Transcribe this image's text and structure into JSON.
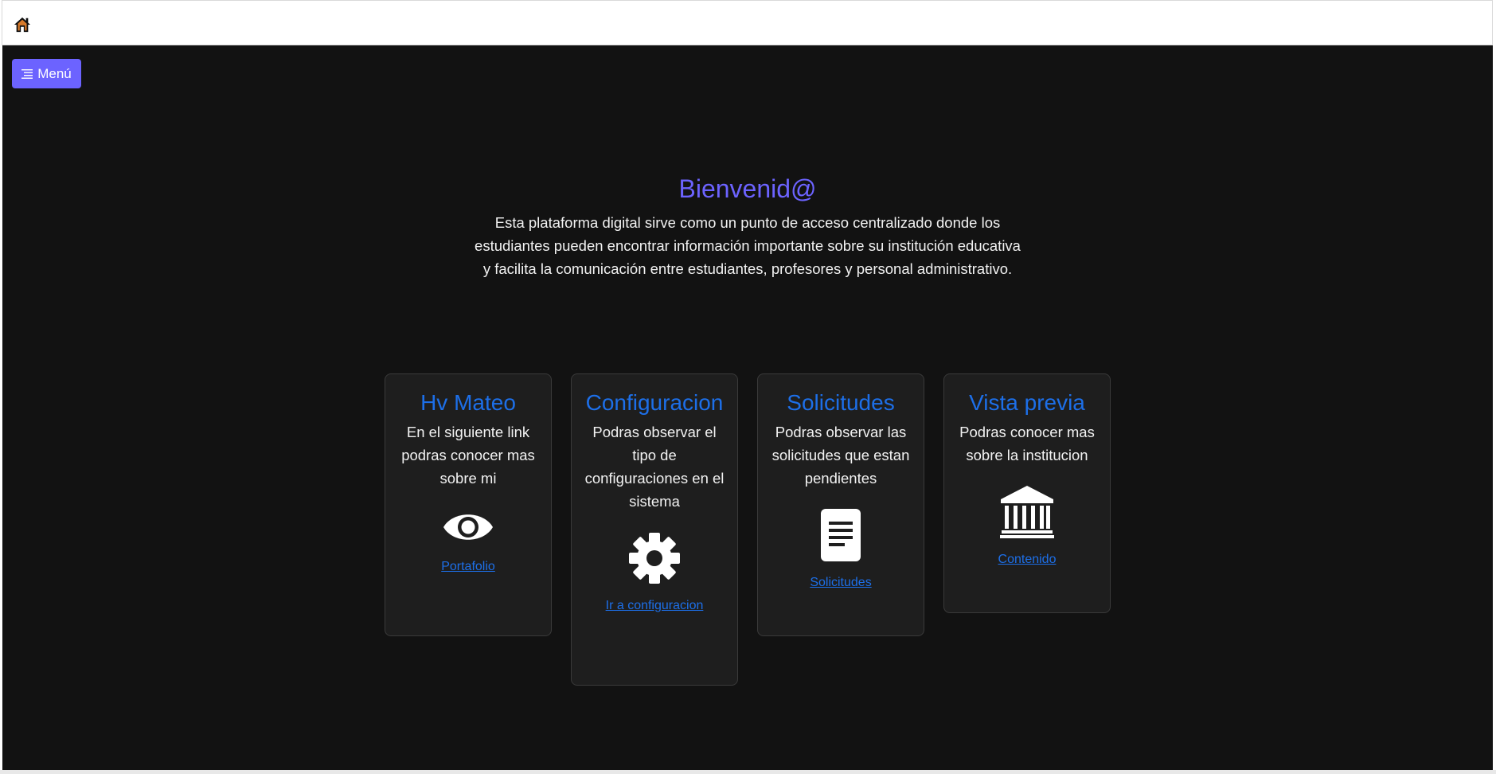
{
  "nav": {
    "home_icon": "home-icon"
  },
  "menu_button": {
    "label": "Menú",
    "icon": "list-icon",
    "color": "#6c63ff"
  },
  "hero": {
    "title": "Bienvenid@",
    "text": "Esta plataforma digital sirve como un punto de acceso centralizado donde los estudiantes pueden encontrar información importante sobre su institución educativa y facilita la comunicación entre estudiantes, profesores y personal administrativo."
  },
  "cards": [
    {
      "title": "Hv Mateo",
      "description": "En el siguiente link podras conocer mas sobre mi",
      "icon": "eye-icon",
      "link": "Portafolio"
    },
    {
      "title": "Configuracion",
      "description": "Podras observar el tipo de configuraciones en el sistema",
      "icon": "gear-icon",
      "link": "Ir a configuracion"
    },
    {
      "title": "Solicitudes",
      "description": "Podras observar las solicitudes que estan pendientes",
      "icon": "document-icon",
      "link": "Solicitudes"
    },
    {
      "title": "Vista previa",
      "description": "Podras conocer mas sobre la institucion",
      "icon": "institution-icon",
      "link": "Contenido"
    }
  ],
  "colors": {
    "accent": "#6c63ff",
    "link": "#1d6fe8",
    "background": "#121212",
    "card": "#1e1e1e"
  }
}
